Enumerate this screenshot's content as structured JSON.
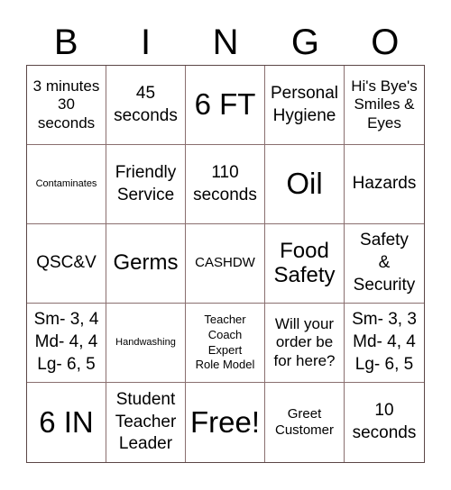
{
  "header": {
    "letters": [
      "B",
      "I",
      "N",
      "G",
      "O"
    ]
  },
  "cells": [
    [
      "3 minutes\n30\nseconds",
      "45\nseconds",
      "6 FT",
      "Personal\nHygiene",
      "Hi's Bye's\nSmiles &\nEyes"
    ],
    [
      "Contaminates",
      "Friendly\nService",
      "110\nseconds",
      "Oil",
      "Hazards"
    ],
    [
      "QSC&V",
      "Germs",
      "CASHDW",
      "Food\nSafety",
      "Safety\n&\nSecurity"
    ],
    [
      "Sm- 3, 4\nMd- 4, 4\nLg- 6, 5",
      "Handwashing",
      "Teacher\nCoach\nExpert\nRole Model",
      "Will your\norder be\nfor here?",
      "Sm- 3, 3\nMd- 4, 4\nLg- 6, 5"
    ],
    [
      "6 IN",
      "Student\nTeacher\nLeader",
      "Free!",
      "Greet\nCustomer",
      "10\nseconds"
    ]
  ],
  "colors": {
    "outer_border": "#5b4646",
    "inner_lines": "#8a6f6f"
  }
}
